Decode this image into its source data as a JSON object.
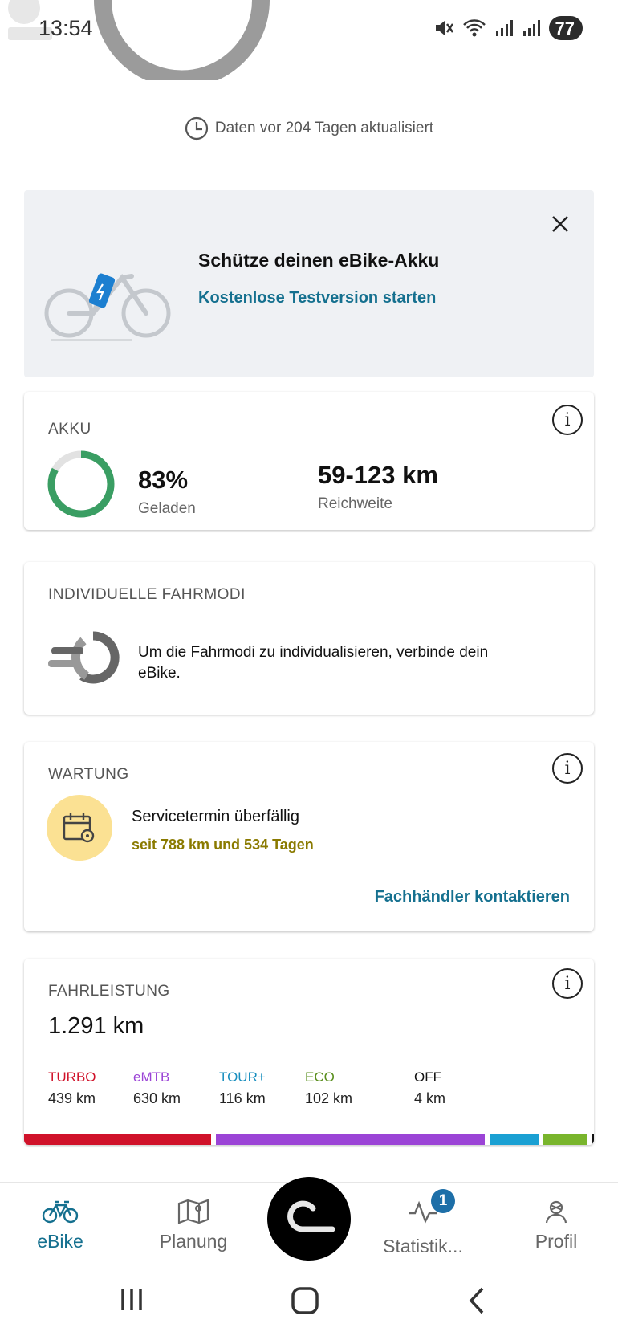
{
  "status_bar": {
    "time": "13:54",
    "battery": "77"
  },
  "sync": {
    "text": "Daten vor 204 Tagen aktualisiert",
    "icon": "clock-icon"
  },
  "promo": {
    "title": "Schütze deinen eBike-Akku",
    "link": "Kostenlose Testversion starten"
  },
  "akku": {
    "title": "AKKU",
    "percent_label": "83%",
    "percent": 0.83,
    "charged_label": "Geladen",
    "range_value": "59-123 km",
    "range_label": "Reichweite",
    "ring_color": "#3a9e63"
  },
  "fahrmodi": {
    "title": "INDIVIDUELLE FAHRMODI",
    "text": "Um die Fahrmodi zu individualisieren, verbinde dein eBike."
  },
  "wartung": {
    "title": "WARTUNG",
    "heading": "Servicetermin überfällig",
    "detail": "seit 788 km und 534 Tagen",
    "link": "Fachhändler kontaktieren"
  },
  "fahrleistung": {
    "title": "FAHRLEISTUNG",
    "total": "1.291 km",
    "modes": [
      {
        "name": "TURBO",
        "value": "439 km",
        "km": 439,
        "color": "#d0122a"
      },
      {
        "name": "eMTB",
        "value": "630 km",
        "km": 630,
        "color": "#9b44d6"
      },
      {
        "name": "TOUR+",
        "value": "116 km",
        "km": 116,
        "color": "#1aa0d3"
      },
      {
        "name": "ECO",
        "value": "102 km",
        "km": 102,
        "color": "#79b52c"
      },
      {
        "name": "OFF",
        "value": "4 km",
        "km": 4,
        "color": "#111111"
      }
    ]
  },
  "nav": {
    "items": [
      {
        "label": "eBike",
        "icon": "bike-icon"
      },
      {
        "label": "Planung",
        "icon": "map-icon"
      },
      {
        "label": "Statistik...",
        "icon": "activity-icon",
        "badge": "1"
      },
      {
        "label": "Profil",
        "icon": "profile-icon"
      }
    ]
  },
  "colors": {
    "accent": "#15708f",
    "warn_bg": "#fbe193",
    "warn_text": "#8a7a00"
  }
}
